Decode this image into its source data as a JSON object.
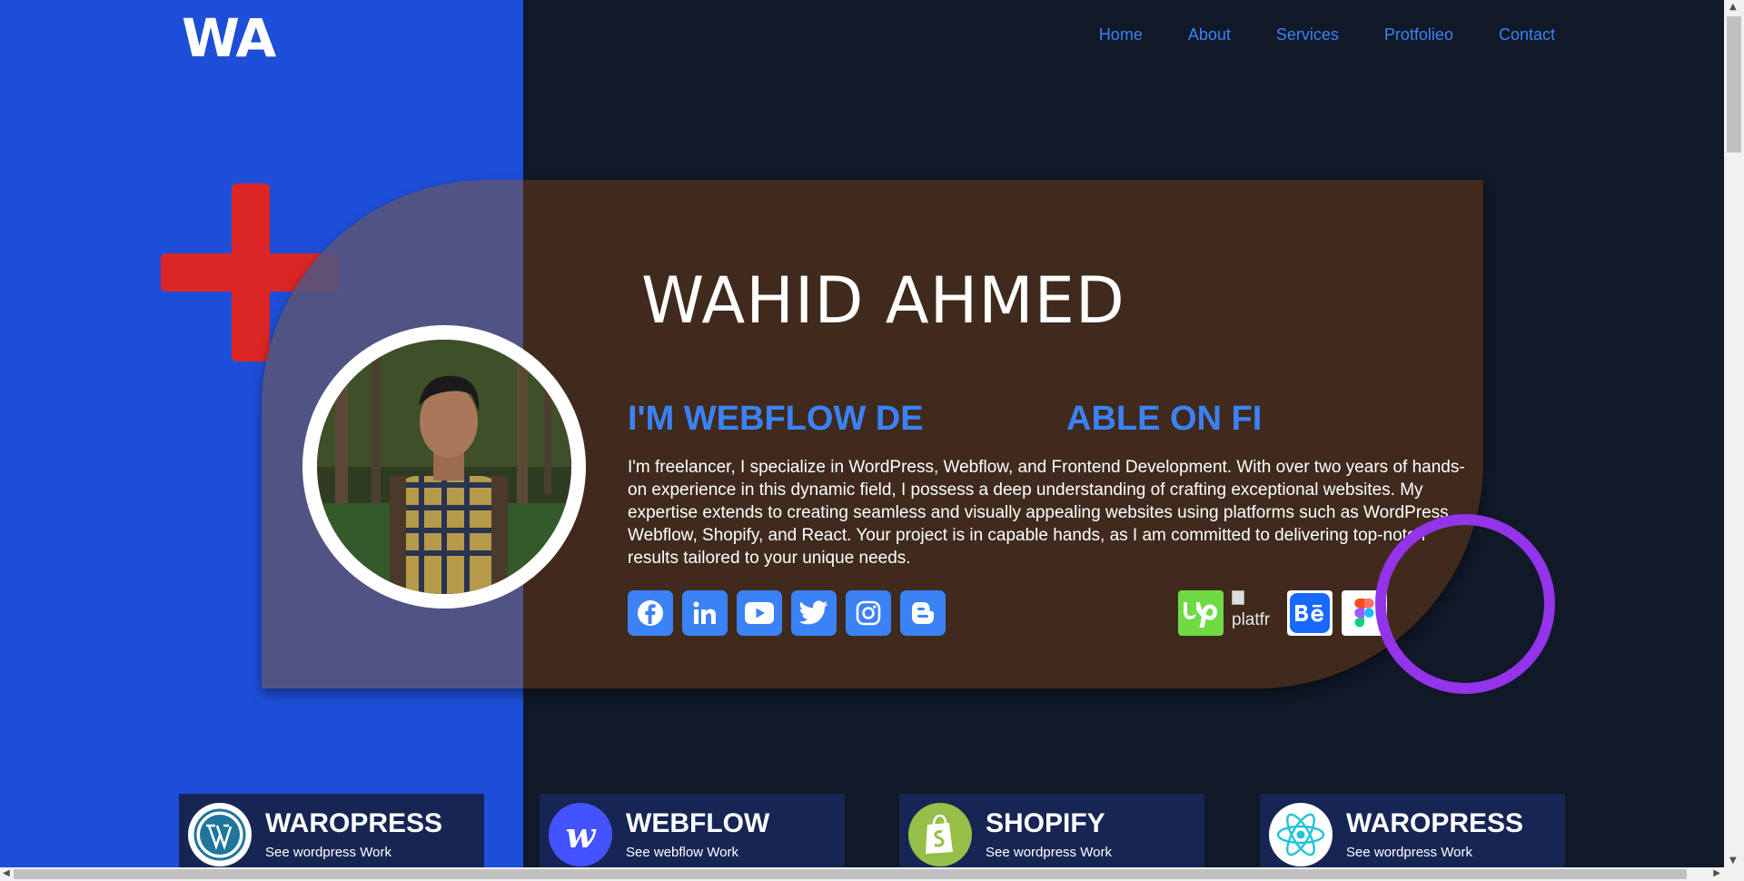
{
  "logo": "WA",
  "nav": [
    "Home",
    "About",
    "Services",
    "Protfolieo",
    "Contact"
  ],
  "hero": {
    "name": "WAHID AHMED",
    "typing_left": "I'M WEBFLOW DE",
    "typing_right": "ABLE ON FI",
    "bio": "I'm freelancer, I specialize in WordPress, Webflow, and Frontend Development. With over two years of hands-on experience in this dynamic field, I possess a deep understanding of crafting exceptional websites. My expertise extends to creating seamless and visually appealing websites using platforms such as WordPress, Webflow, Shopify, and React. Your project is in capable hands, as I am committed to delivering top-notch results tailored to your unique needs.",
    "broken_image_alt": "platfr"
  },
  "social_icons": [
    "facebook-icon",
    "linkedin-icon",
    "youtube-icon",
    "twitter-icon",
    "instagram-icon",
    "blogger-icon"
  ],
  "platform_icons": [
    "upwork-icon",
    "broken-image",
    "behance-icon",
    "figma-icon"
  ],
  "services": [
    {
      "title": "WAROPRESS",
      "subtitle": "See wordpress Work",
      "icon": "wordpress-icon"
    },
    {
      "title": "WEBFLOW",
      "subtitle": "See webflow Work",
      "icon": "webflow-icon"
    },
    {
      "title": "SHOPIFY",
      "subtitle": "See wordpress Work",
      "icon": "shopify-icon"
    },
    {
      "title": "WAROPRESS",
      "subtitle": "See wordpress Work",
      "icon": "react-icon"
    }
  ],
  "colors": {
    "left_panel": "#1d4ed8",
    "background": "#111827",
    "accent_blue": "#3b82f6",
    "plus_red": "#dc2626",
    "ring_purple": "#9333ea",
    "card_brown": "#3f2a1d",
    "service_card": "#172554"
  }
}
